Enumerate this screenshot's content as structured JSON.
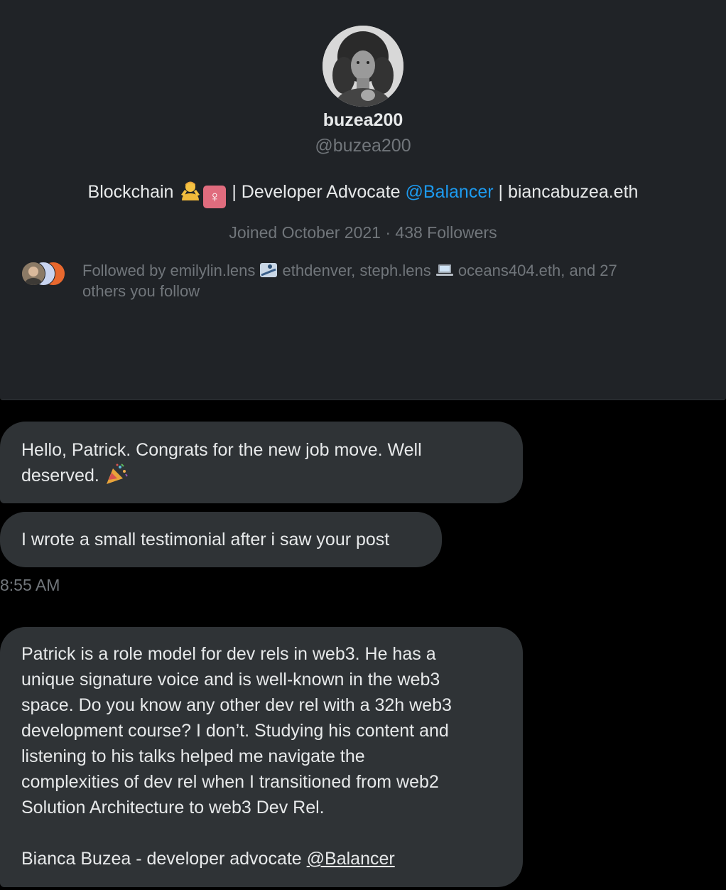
{
  "profile": {
    "display_name": "buzea200",
    "handle": "@buzea200",
    "bio": {
      "prefix": "Blockchain",
      "emoji_person": "person-gesturing-icon",
      "emoji_female": "♀",
      "middle": " | Developer Advocate ",
      "mention": "@Balancer",
      "suffix": " | biancabuzea.eth"
    },
    "joined": "Joined October 2021 · 438 Followers",
    "followed_by": {
      "line1_a": "Followed by emilylin.lens ",
      "line1_b": " ethdenver, steph.lens ",
      "line1_c": " oceans404.eth, and 27",
      "line2": "others you follow"
    }
  },
  "messages": [
    {
      "lines": [
        "Hello, Patrick. Congrats for the new job move. Well",
        "deserved. "
      ]
    },
    {
      "lines": [
        "I wrote a small testimonial after i saw your post"
      ]
    }
  ],
  "timestamp": "8:55 AM",
  "testimonial": {
    "lines": [
      "Patrick is a role model for dev rels in web3. He has a",
      "unique signature voice and is well-known in the web3",
      "space. Do you know any other dev rel with a 32h web3",
      "development course? I don’t. Studying his content and",
      "listening to his talks helped me navigate the",
      "complexities of dev rel when I transitioned from web2",
      "Solution Architecture to web3 Dev Rel."
    ],
    "signature": "Bianca Buzea - developer advocate ",
    "signature_link": "@Balancer"
  },
  "colors": {
    "card_bg": "#202327",
    "bubble_bg": "#2f3336",
    "muted_text": "#71767b",
    "link": "#1d9bf0"
  }
}
